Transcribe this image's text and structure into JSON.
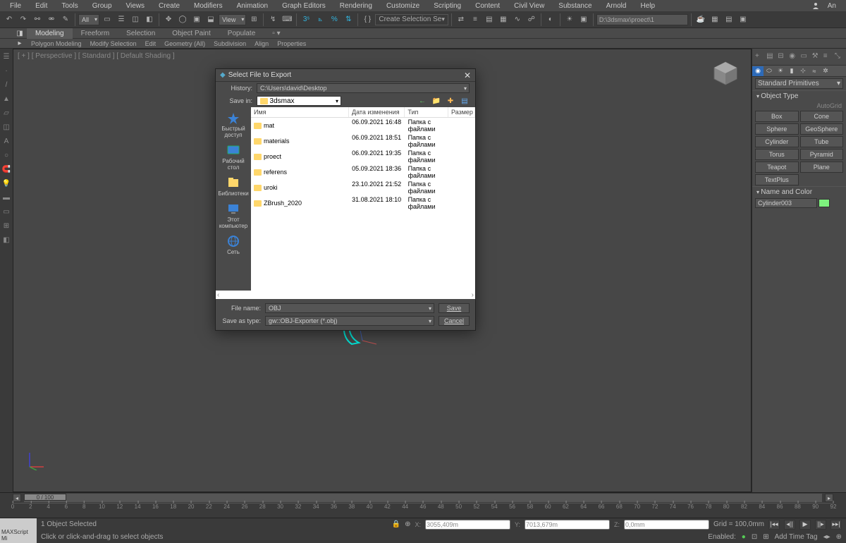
{
  "menu": [
    "File",
    "Edit",
    "Tools",
    "Group",
    "Views",
    "Create",
    "Modifiers",
    "Animation",
    "Graph Editors",
    "Rendering",
    "Customize",
    "Scripting",
    "Content",
    "Civil View",
    "Substance",
    "Arnold",
    "Help"
  ],
  "user": "An",
  "toolbar": {
    "all": "All",
    "view": "View",
    "selset": "Create Selection Se",
    "path": "D:\\3dsmax\\proect\\1"
  },
  "ribbon": {
    "tabs": [
      "Modeling",
      "Freeform",
      "Selection",
      "Object Paint",
      "Populate"
    ],
    "sub": [
      "Polygon Modeling",
      "Modify Selection",
      "Edit",
      "Geometry (All)",
      "Subdivision",
      "Align",
      "Properties"
    ]
  },
  "viewport": {
    "label": "[ + ] [ Perspective ] [ Standard ] [ Default Shading ]"
  },
  "rightPanel": {
    "category": "Standard Primitives",
    "sections": {
      "objType": "Object Type",
      "nameColor": "Name and Color"
    },
    "autogrid": "AutoGrid",
    "buttons": [
      [
        "Box",
        "Cone"
      ],
      [
        "Sphere",
        "GeoSphere"
      ],
      [
        "Cylinder",
        "Tube"
      ],
      [
        "Torus",
        "Pyramid"
      ],
      [
        "Teapot",
        "Plane"
      ],
      [
        "TextPlus",
        ""
      ]
    ],
    "objName": "Cylinder003"
  },
  "timeline": {
    "frame": "0 / 100",
    "ticks": [
      0,
      2,
      4,
      6,
      8,
      10,
      12,
      14,
      16,
      18,
      20,
      22,
      24,
      26,
      28,
      30,
      32,
      34,
      36,
      38,
      40,
      42,
      44,
      46,
      48,
      50,
      52,
      54,
      56,
      58,
      60,
      62,
      64,
      66,
      68,
      70,
      72,
      74,
      76,
      78,
      80,
      82,
      84,
      86,
      88,
      90,
      92
    ]
  },
  "status": {
    "script": "MAXScript Mi",
    "sel": "1 Object Selected",
    "hint": "Click or click-and-drag to select objects",
    "x": "X:",
    "xv": "3055,409m",
    "y": "Y:",
    "yv": "7013,679m",
    "z": "Z:",
    "zv": "0,0mm",
    "grid": "Grid = 100,0mm",
    "enabled": "Enabled:",
    "addtag": "Add Time Tag"
  },
  "dialog": {
    "title": "Select File to Export",
    "history": "History:",
    "historyVal": "C:\\Users\\david\\Desktop",
    "savein": "Save in:",
    "saveinVal": "3dsmax",
    "cols": {
      "name": "Имя",
      "date": "Дата изменения",
      "type": "Тип",
      "size": "Размер"
    },
    "rows": [
      {
        "n": "mat",
        "d": "06.09.2021 16:48",
        "t": "Папка с файлами"
      },
      {
        "n": "materials",
        "d": "06.09.2021 18:51",
        "t": "Папка с файлами"
      },
      {
        "n": "proect",
        "d": "06.09.2021 19:35",
        "t": "Папка с файлами"
      },
      {
        "n": "referens",
        "d": "05.09.2021 18:36",
        "t": "Папка с файлами"
      },
      {
        "n": "uroki",
        "d": "23.10.2021 21:52",
        "t": "Папка с файлами"
      },
      {
        "n": "ZBrush_2020",
        "d": "31.08.2021 18:10",
        "t": "Папка с файлами"
      }
    ],
    "side": [
      "Быстрый доступ",
      "Рабочий стол",
      "Библиотеки",
      "Этот компьютер",
      "Сеть"
    ],
    "fileName": "File name:",
    "fileNameVal": "OBJ",
    "saveType": "Save as type:",
    "saveTypeVal": "gw::OBJ-Exporter (*.obj)",
    "save": "Save",
    "cancel": "Cancel"
  }
}
